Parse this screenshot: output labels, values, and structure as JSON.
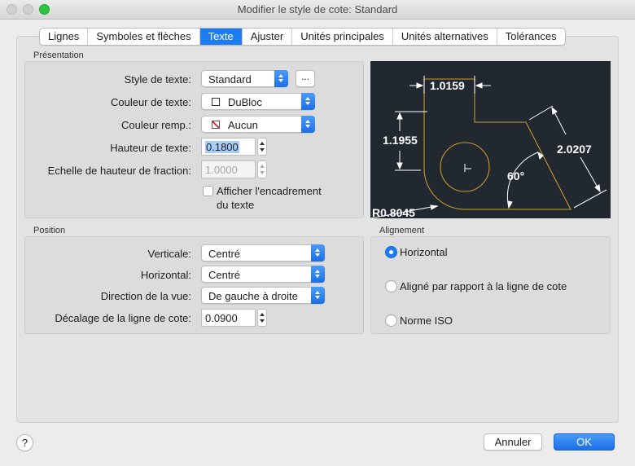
{
  "window": {
    "title": "Modifier le style de cote: Standard"
  },
  "tabs": [
    {
      "label": "Lignes"
    },
    {
      "label": "Symboles et flèches"
    },
    {
      "label": "Texte"
    },
    {
      "label": "Ajuster"
    },
    {
      "label": "Unités principales"
    },
    {
      "label": "Unités alternatives"
    },
    {
      "label": "Tolérances"
    }
  ],
  "active_tab": "Texte",
  "presentation": {
    "title": "Présentation",
    "text_style_label": "Style de texte:",
    "text_style_value": "Standard",
    "dots_label": "...",
    "text_color_label": "Couleur de texte:",
    "text_color_value": "DuBloc",
    "fill_color_label": "Couleur remp.:",
    "fill_color_value": "Aucun",
    "text_height_label": "Hauteur de texte:",
    "text_height_value": "0.1800",
    "fraction_scale_label": "Echelle de hauteur de fraction:",
    "fraction_scale_value": "1.0000",
    "frame_checkbox_line1": "Afficher l'encadrement",
    "frame_checkbox_line2": "du texte",
    "frame_checked": false
  },
  "preview": {
    "dim_top": "1.0159",
    "dim_left": "1.1955",
    "dim_right": "2.0207",
    "dim_angle": "60°",
    "dim_radius": "R0.8045",
    "colors": {
      "background": "#212830",
      "geometry": "#c89a2a",
      "dimension": "#ffffff"
    }
  },
  "position": {
    "title": "Position",
    "vertical_label": "Verticale:",
    "vertical_value": "Centré",
    "horizontal_label": "Horizontal:",
    "horizontal_value": "Centré",
    "view_direction_label": "Direction de la vue:",
    "view_direction_value": "De gauche à droite",
    "offset_label": "Décalage de la ligne de cote:",
    "offset_value": "0.0900"
  },
  "alignment": {
    "title": "Alignement",
    "options": [
      {
        "label": "Horizontal",
        "selected": true
      },
      {
        "label": "Aligné par rapport à la ligne de cote",
        "selected": false
      },
      {
        "label": "Norme ISO",
        "selected": false
      }
    ]
  },
  "footer": {
    "help_label": "?",
    "cancel_label": "Annuler",
    "ok_label": "OK"
  },
  "colors": {
    "accent": "#1c7cf4"
  }
}
